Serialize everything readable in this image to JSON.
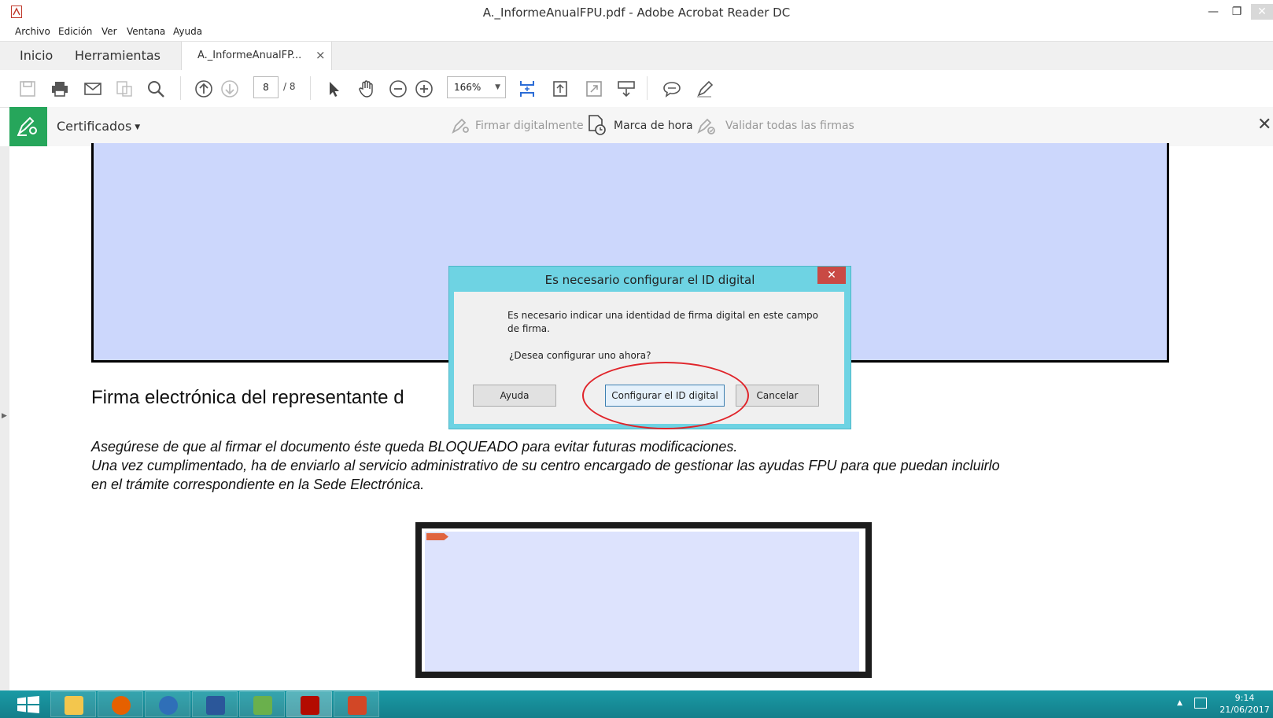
{
  "window": {
    "title": "A._InformeAnualFPU.pdf - Adobe Acrobat Reader DC"
  },
  "menu": [
    "Archivo",
    "Edición",
    "Ver",
    "Ventana",
    "Ayuda"
  ],
  "tabs": {
    "home": "Inicio",
    "tools": "Herramientas",
    "document": "A._InformeAnualFP...",
    "close": "×"
  },
  "toolbar": {
    "page_current": "8",
    "page_total": "/ 8",
    "zoom": "166%"
  },
  "certbar": {
    "title": "Certificados",
    "sign": "Firmar digitalmente",
    "timestamp": "Marca de hora",
    "validate": "Validar todas las firmas"
  },
  "document": {
    "heading": "Firma electrónica del representante d",
    "para1": "Asegúrese de que al firmar el documento éste queda BLOQUEADO para evitar futuras modificaciones.",
    "para2": "Una vez cumplimentado, ha de enviarlo al servicio administrativo de su centro encargado de gestionar las ayudas FPU para que puedan incluirlo",
    "para3": "en el trámite correspondiente en la Sede Electrónica."
  },
  "dialog": {
    "title": "Es necesario configurar el ID digital",
    "close": "✕",
    "message": "Es necesario indicar una identidad de firma digital en este campo de firma.",
    "question": "¿Desea configurar uno ahora?",
    "help_button": "Ayuda",
    "configure_button": "Configurar el ID digital",
    "cancel_button": "Cancelar"
  },
  "taskbar": {
    "time": "9:14",
    "date": "21/06/2017"
  },
  "colors": {
    "cert_accent": "#26a65b",
    "dialog_frame": "#6ed3e3",
    "taskbar": "#1a9aa5",
    "sig_field": "#ccd7fc",
    "annotation": "#e0242a"
  }
}
